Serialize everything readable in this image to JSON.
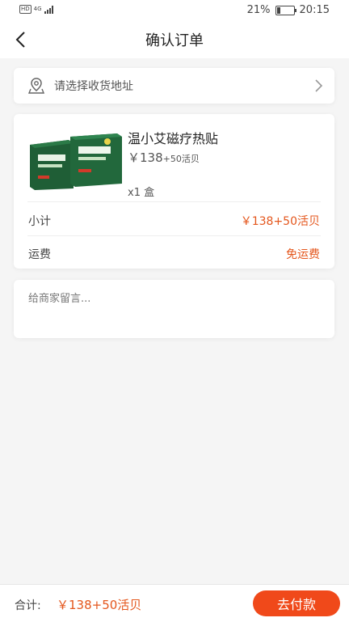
{
  "status_bar": {
    "hd": "HD",
    "network": "4G",
    "battery_percent": "21%",
    "battery_level": 0.21,
    "time": "20:15"
  },
  "nav": {
    "title": "确认订单",
    "back_icon": "chevron-left-icon"
  },
  "address": {
    "placeholder": "请选择收货地址",
    "icon": "location-pin-icon",
    "chevron_icon": "chevron-right-icon"
  },
  "product": {
    "name": "温小艾磁疗热贴",
    "price_symbol": "￥",
    "price_main": "138",
    "price_extra": "+50活贝",
    "quantity": "x1 盒",
    "image": "product-box-image"
  },
  "summary": {
    "subtotal_label": "小计",
    "subtotal_value": "￥138+50活贝",
    "shipping_label": "运费",
    "shipping_value": "免运费"
  },
  "message": {
    "placeholder": "给商家留言..."
  },
  "footer": {
    "total_label": "合计:",
    "total_value": "￥138+50活贝",
    "pay_button": "去付款"
  },
  "colors": {
    "accent": "#f0491a",
    "price": "#e4561c",
    "background": "#f5f5f5"
  }
}
